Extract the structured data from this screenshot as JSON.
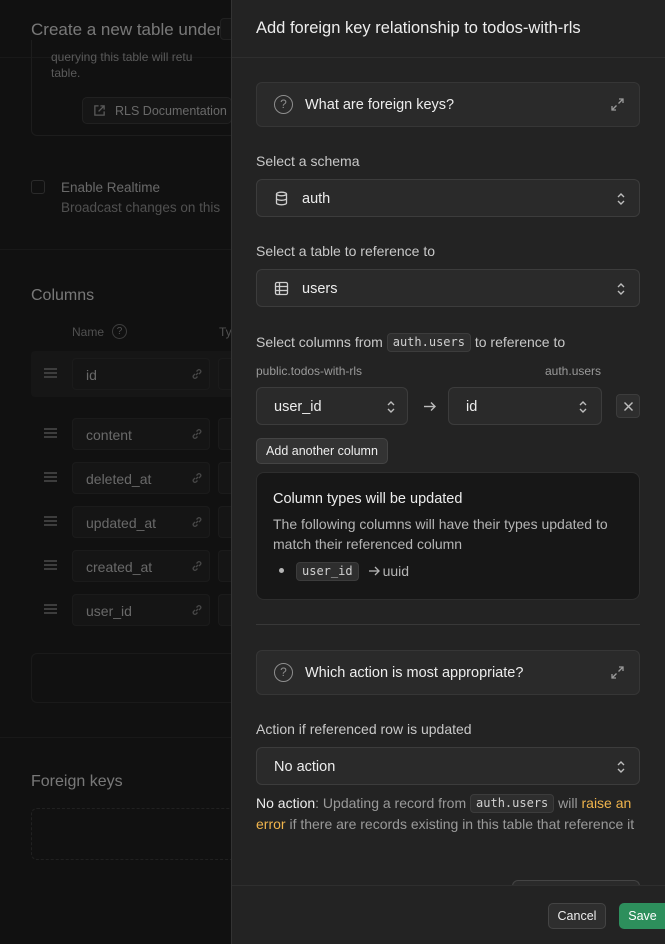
{
  "background": {
    "title": "Create a new table under",
    "rls_text": "querying this table will retu table.",
    "rls_button": "RLS Documentation",
    "realtime_label": "Enable Realtime",
    "realtime_desc": "Broadcast changes on this",
    "columns_title": "Columns",
    "columns_header_name": "Name",
    "columns_header_type": "Ty",
    "rows": [
      "id",
      "content",
      "deleted_at",
      "updated_at",
      "created_at",
      "user_id"
    ],
    "foreign_keys_title": "Foreign keys"
  },
  "panel": {
    "title": "Add foreign key relationship to todos-with-rls",
    "what_are_fks": "What are foreign keys?",
    "schema_label": "Select a schema",
    "schema_value": "auth",
    "table_label": "Select a table to reference to",
    "table_value": "users",
    "columns_label_prefix": "Select columns from",
    "columns_label_code": "auth.users",
    "columns_label_suffix": "to reference to",
    "source_table": "public.todos-with-rls",
    "target_table": "auth.users",
    "source_column": "user_id",
    "target_column": "id",
    "add_column_button": "Add another column",
    "types_title": "Column types will be updated",
    "types_desc": "The following columns will have their types updated to match their referenced column",
    "types_item_column": "user_id",
    "types_item_type": "uuid",
    "which_action": "Which action is most appropriate?",
    "action_label": "Action if referenced row is updated",
    "action_value": "No action",
    "note_strong": "No action",
    "note_part1": ": Updating a record from",
    "note_code": "auth.users",
    "note_part2": "will",
    "note_link": "raise an error",
    "note_part3": "if there are records existing in this table that reference it",
    "cancel_button": "Cancel",
    "save_button": "Save"
  },
  "colors": {
    "accent_green": "#2d8f5c",
    "warning_orange": "#f0b44c",
    "panel_bg": "#232323"
  }
}
